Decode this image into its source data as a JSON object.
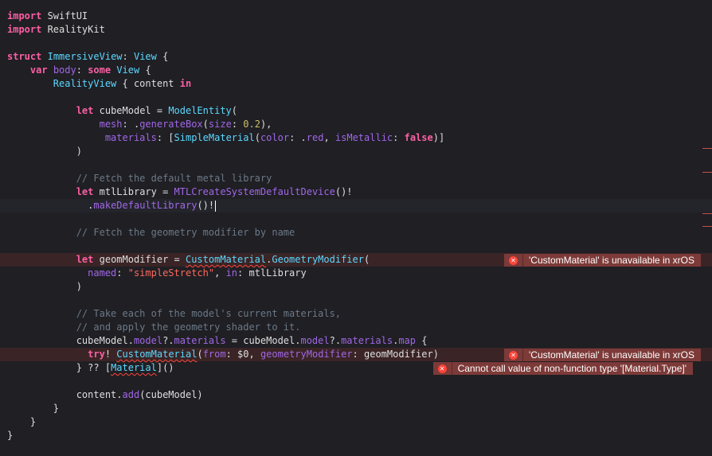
{
  "code": {
    "l1": [
      "import",
      " SwiftUI"
    ],
    "l2": [
      "import",
      " RealityKit"
    ],
    "l4": [
      "struct",
      "ImmersiveView",
      ": ",
      "View",
      " {"
    ],
    "l5": [
      "var",
      "body",
      ": ",
      "some",
      "View",
      " {"
    ],
    "l6": [
      "RealityView",
      " { content ",
      "in"
    ],
    "l8": [
      "let",
      " cubeModel = ",
      "ModelEntity",
      "("
    ],
    "l9": [
      "mesh",
      ": .",
      "generateBox",
      "(",
      "size",
      ": ",
      "0.2",
      "),"
    ],
    "l10": [
      "materials",
      ": [",
      "SimpleMaterial",
      "(",
      "color",
      ": .",
      "red",
      ", ",
      "isMetallic",
      ": ",
      "false",
      ")]"
    ],
    "l11": ")",
    "l13": "// Fetch the default metal library",
    "l14": [
      "let",
      " mtlLibrary = ",
      "MTLCreateSystemDefaultDevice",
      "()!"
    ],
    "l15": [
      ".",
      "makeDefaultLibrary",
      "()!"
    ],
    "l17": "// Fetch the geometry modifier by name",
    "l19": [
      "let",
      " geomModifier = ",
      "CustomMaterial",
      ".",
      "GeometryModifier",
      "("
    ],
    "l20": [
      "named",
      ": ",
      "\"simpleStretch\"",
      ", ",
      "in",
      ": mtlLibrary"
    ],
    "l21": ")",
    "l23": "// Take each of the model's current materials,",
    "l24": "// and apply the geometry shader to it.",
    "l25": [
      "cubeModel.",
      "model",
      "?.",
      "materials",
      " = cubeModel.",
      "model",
      "?.",
      "materials",
      ".",
      "map",
      " {"
    ],
    "l26": [
      "try",
      "! ",
      "CustomMaterial",
      "(",
      "from",
      ": $0, ",
      "geometryModifier",
      ": geomModifier)"
    ],
    "l27": [
      "} ?? [",
      "Material",
      "]()"
    ],
    "l29": [
      "content.",
      "add",
      "(cubeModel)"
    ],
    "l30": "}",
    "l31": "}",
    "l32": "}"
  },
  "errors": {
    "e1": "'CustomMaterial' is unavailable in xrOS",
    "e2": "'CustomMaterial' is unavailable in xrOS",
    "e3": "Cannot call value of non-function type '[Material.Type]'"
  },
  "colors": {
    "background": "#1f1f24",
    "keyword": "#fc5fa3",
    "type": "#5dd8ff",
    "function": "#a167e6",
    "number": "#d0bf69",
    "string": "#fc6a5d",
    "comment": "#6c7986",
    "error_badge": "#7c3a38",
    "error_line": "#3a2426"
  },
  "icons": {
    "error": "x-circle-icon"
  }
}
